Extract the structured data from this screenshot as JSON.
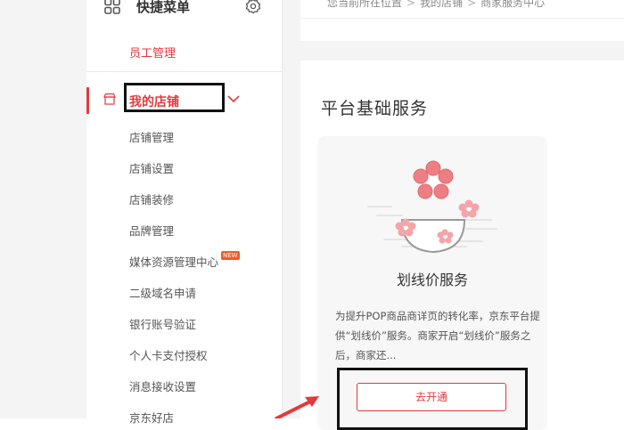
{
  "sidebar": {
    "quick_menu_title": "快捷菜单",
    "staff_label": "员工管理",
    "store_label": "我的店铺",
    "sub_items": [
      {
        "label": "店铺管理"
      },
      {
        "label": "店铺设置"
      },
      {
        "label": "店铺装修"
      },
      {
        "label": "品牌管理"
      },
      {
        "label": "媒体资源管理中心",
        "badge": "NEW"
      },
      {
        "label": "二级域名申请"
      },
      {
        "label": "银行账号验证"
      },
      {
        "label": "个人卡支付授权"
      },
      {
        "label": "消息接收设置"
      },
      {
        "label": "京东好店"
      }
    ]
  },
  "breadcrumb": {
    "prefix": "您当前所在位置",
    "items": [
      "我的店铺",
      "商家服务中心"
    ]
  },
  "main": {
    "section_title": "平台基础服务",
    "card": {
      "name": "划线价服务",
      "description": "为提升POP商品商详页的转化率，京东平台提供“划线价”服务。商家开启“划线价”服务之后，商家还...",
      "button_label": "去开通"
    }
  },
  "colors": {
    "accent": "#e4393c",
    "flower": "#ee7e84",
    "background": "#f4f4f4"
  },
  "icons": [
    "grid-icon",
    "gear-icon",
    "store-icon",
    "chevron-down-icon",
    "flower-illustration",
    "arrow-annotation"
  ]
}
